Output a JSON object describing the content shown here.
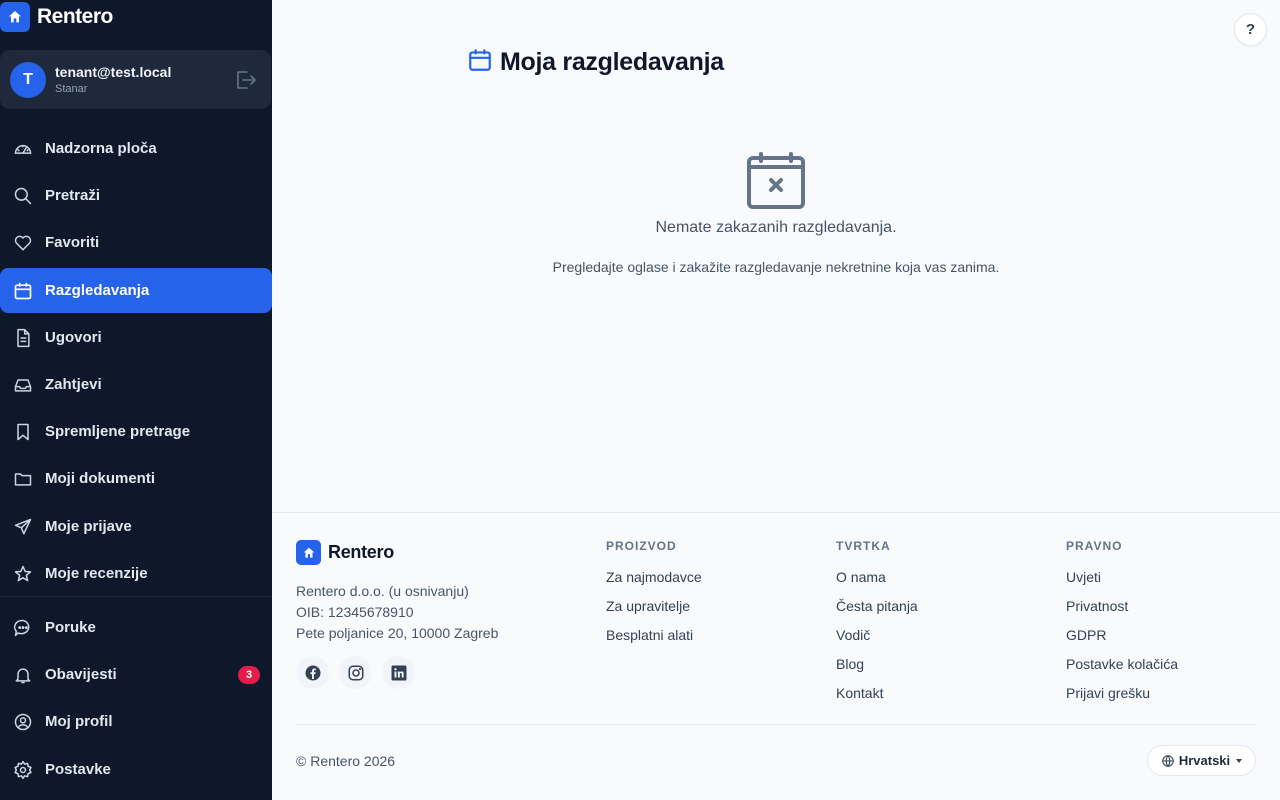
{
  "brand": {
    "name": "Rentero"
  },
  "user": {
    "initial": "T",
    "email": "tenant@test.local",
    "role": "Stanar"
  },
  "nav": {
    "items": [
      {
        "label": "Nadzorna ploča",
        "icon": "dashboard-icon"
      },
      {
        "label": "Pretraži",
        "icon": "search-icon"
      },
      {
        "label": "Favoriti",
        "icon": "heart-icon"
      },
      {
        "label": "Razgledavanja",
        "icon": "calendar-icon",
        "active": true
      },
      {
        "label": "Ugovori",
        "icon": "document-icon"
      },
      {
        "label": "Zahtjevi",
        "icon": "inbox-icon"
      },
      {
        "label": "Spremljene pretrage",
        "icon": "bookmark-icon"
      },
      {
        "label": "Moji dokumenti",
        "icon": "folder-icon"
      },
      {
        "label": "Moje prijave",
        "icon": "send-icon"
      },
      {
        "label": "Moje recenzije",
        "icon": "star-icon"
      }
    ],
    "bottom": [
      {
        "label": "Poruke",
        "icon": "chat-icon"
      },
      {
        "label": "Obavijesti",
        "icon": "bell-icon",
        "badge": "3"
      },
      {
        "label": "Moj profil",
        "icon": "user-circle-icon"
      },
      {
        "label": "Postavke",
        "icon": "gear-icon"
      }
    ]
  },
  "help": {
    "label": "?"
  },
  "page": {
    "title": "Moja razgledavanja"
  },
  "empty": {
    "title": "Nemate zakazanih razgledavanja.",
    "subtitle": "Pregledajte oglase i zakažite razgledavanje nekretnine koja vas zanima."
  },
  "footer": {
    "brand": "Rentero",
    "company_lines": [
      "Rentero d.o.o. (u osnivanju)",
      "OIB: 12345678910",
      "Pete poljanice 20, 10000 Zagreb"
    ],
    "socials": [
      "facebook-icon",
      "instagram-icon",
      "linkedin-icon"
    ],
    "columns": [
      {
        "title": "PROIZVOD",
        "links": [
          "Za najmodavce",
          "Za upravitelje",
          "Besplatni alati"
        ]
      },
      {
        "title": "TVRTKA",
        "links": [
          "O nama",
          "Česta pitanja",
          "Vodič",
          "Blog",
          "Kontakt"
        ]
      },
      {
        "title": "PRAVNO",
        "links": [
          "Uvjeti",
          "Privatnost",
          "GDPR",
          "Postavke kolačića",
          "Prijavi grešku"
        ]
      }
    ],
    "copyright": "© Rentero 2026",
    "language": "Hrvatski"
  },
  "colors": {
    "accent": "#2563eb",
    "sidebar": "#0f172a",
    "badge": "#e11d48"
  }
}
